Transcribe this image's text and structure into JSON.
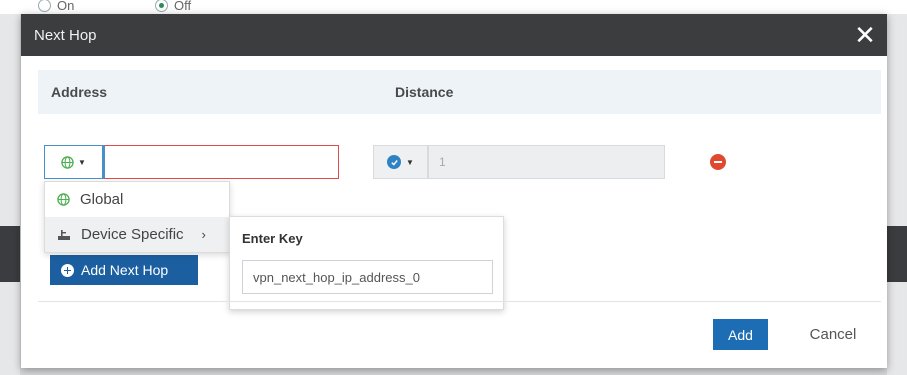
{
  "background": {
    "radio_on_label": "On",
    "radio_off_label": "Off"
  },
  "modal": {
    "title": "Next Hop",
    "close_glyph": "✕"
  },
  "table": {
    "col_address": "Address",
    "col_distance": "Distance"
  },
  "row": {
    "address_type_icon": "globe-icon",
    "address_value": "",
    "distance_value": "1",
    "distance_icon": "check-circle-icon"
  },
  "address_menu": {
    "items": [
      {
        "label": "Global",
        "icon": "globe-icon"
      },
      {
        "label": "Device Specific",
        "icon": "device-icon",
        "chevron": "›"
      }
    ]
  },
  "device_submenu": {
    "label": "Enter Key",
    "key_value": "vpn_next_hop_ip_address_0"
  },
  "add_next_hop_label": "Add Next Hop",
  "footer": {
    "add_label": "Add",
    "cancel_label": "Cancel"
  },
  "colors": {
    "header_bg": "#3c3d3f",
    "primary": "#1c6db3",
    "danger": "#e0492f",
    "error_border": "#e04b4b"
  }
}
